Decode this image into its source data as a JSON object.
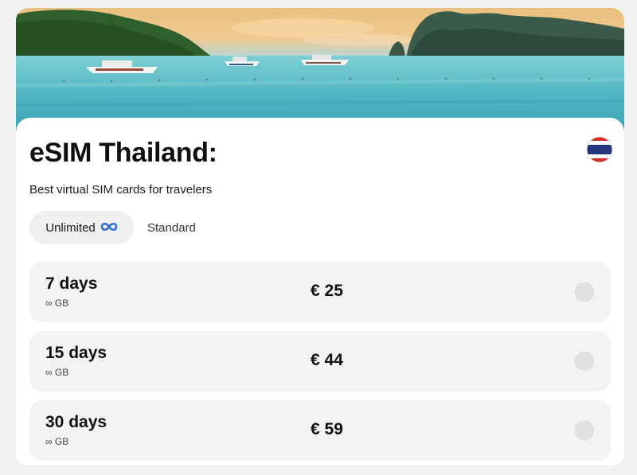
{
  "hero": {
    "image": "thailand-beach-boats-limestone-cliffs"
  },
  "header": {
    "title": "eSIM Thailand:",
    "subtitle": "Best virtual SIM cards for travelers",
    "flag_icon": "thailand-flag-icon"
  },
  "tabs": [
    {
      "label": "Unlimited",
      "icon": "infinity-icon",
      "selected": true
    },
    {
      "label": "Standard",
      "selected": false
    }
  ],
  "plans": [
    {
      "days": "7 days",
      "data": "∞ GB",
      "price": "€ 25",
      "selected": false
    },
    {
      "days": "15 days",
      "data": "∞ GB",
      "price": "€ 44",
      "selected": false
    },
    {
      "days": "30 days",
      "data": "∞ GB",
      "price": "€ 59",
      "selected": false
    }
  ],
  "colors": {
    "accent_infinity": "#2f6fd6",
    "flag_red": "#d62b2b",
    "flag_blue": "#24357a",
    "card_bg": "#f3f3f3"
  }
}
